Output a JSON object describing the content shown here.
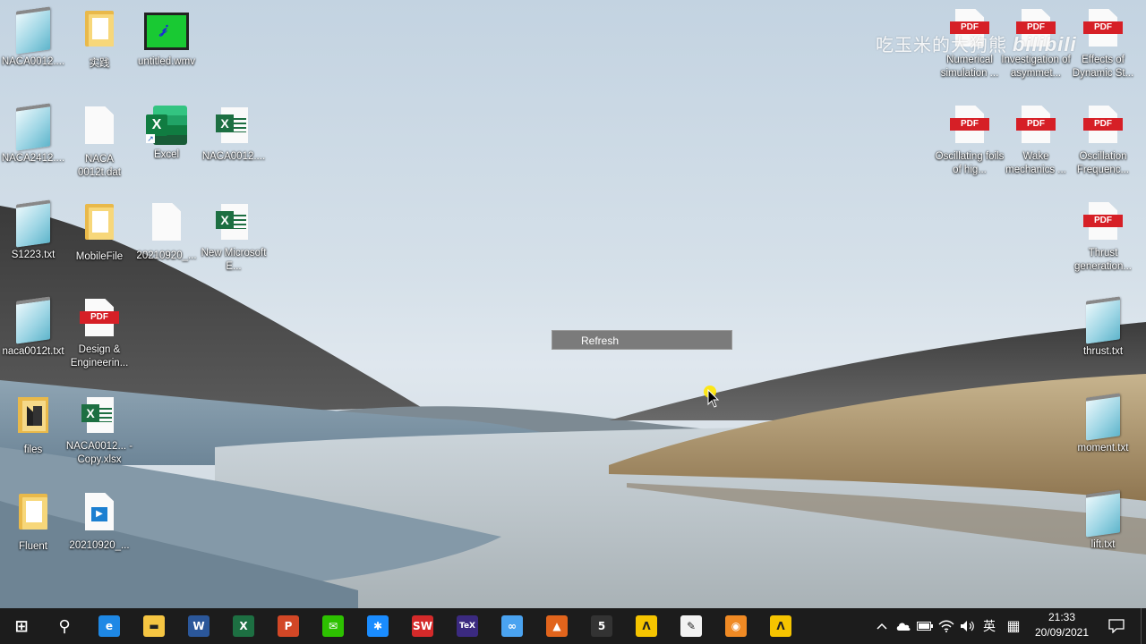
{
  "desktop": {
    "icons": [
      {
        "label": "NACA0012....",
        "type": "txt"
      },
      {
        "label": "实践",
        "type": "pdffolder"
      },
      {
        "label": "untitled.wmv",
        "type": "wmv"
      },
      {
        "label": "NACA2412....",
        "type": "txt"
      },
      {
        "label": "NACA 0012t.dat",
        "type": "doc"
      },
      {
        "label": "Excel",
        "type": "excelapp"
      },
      {
        "label": "NACA0012....",
        "type": "xlsx"
      },
      {
        "label": "S1223.txt",
        "type": "txt"
      },
      {
        "label": "MobileFile",
        "type": "folder"
      },
      {
        "label": "20210920_...",
        "type": "doc"
      },
      {
        "label": "New Microsoft E...",
        "type": "xlsx"
      },
      {
        "label": "naca0012t.txt",
        "type": "txt"
      },
      {
        "label": "Design & Engineerin...",
        "type": "pdf"
      },
      {
        "label": "files",
        "type": "ideafolder"
      },
      {
        "label": "NACA0012... - Copy.xlsx",
        "type": "xlsx"
      },
      {
        "label": "Fluent",
        "type": "folder"
      },
      {
        "label": "20210920_...",
        "type": "video"
      },
      {
        "label": "Numerical simulation ...",
        "type": "pdf"
      },
      {
        "label": "Investigation of asymmet...",
        "type": "pdf"
      },
      {
        "label": "Effects of Dynamic St...",
        "type": "pdf"
      },
      {
        "label": "Oscillating foils of hig...",
        "type": "pdf"
      },
      {
        "label": "Wake mechanics ...",
        "type": "pdf"
      },
      {
        "label": "Oscillation Frequenc...",
        "type": "pdf"
      },
      {
        "label": "Thrust generation...",
        "type": "pdf"
      },
      {
        "label": "thrust.txt",
        "type": "txt"
      },
      {
        "label": "moment.txt",
        "type": "txt"
      },
      {
        "label": "lift.txt",
        "type": "txt"
      }
    ],
    "pdf_tag": "PDF",
    "excel_letter": "X"
  },
  "context_menu": {
    "refresh_label": "Refresh"
  },
  "watermark": {
    "text": "吃玉米的大狗熊",
    "brand": "bilibili"
  },
  "taskbar": {
    "apps": [
      {
        "name": "start-button",
        "glyph": "⊞",
        "color": "#ffffff"
      },
      {
        "name": "search-button",
        "glyph": "⚲",
        "color": "#ffffff"
      },
      {
        "name": "edge-icon",
        "glyph": "e",
        "color": "#1e88e5"
      },
      {
        "name": "file-explorer-icon",
        "glyph": "▬",
        "color": "#f5c542"
      },
      {
        "name": "word-icon",
        "glyph": "W",
        "color": "#2b579a"
      },
      {
        "name": "excel-taskbar-icon",
        "glyph": "X",
        "color": "#1d6f42"
      },
      {
        "name": "powerpoint-icon",
        "glyph": "P",
        "color": "#d24726"
      },
      {
        "name": "wechat-icon",
        "glyph": "✉",
        "color": "#2dc100"
      },
      {
        "name": "star-app-icon",
        "glyph": "✱",
        "color": "#1a8cff"
      },
      {
        "name": "solidworks-icon",
        "glyph": "SW",
        "color": "#d42a2a"
      },
      {
        "name": "tex-icon",
        "glyph": "TeX",
        "color": "#3b2a80"
      },
      {
        "name": "cloud-sync-icon",
        "glyph": "∞",
        "color": "#4aa3f0"
      },
      {
        "name": "matlab-icon",
        "glyph": "▲",
        "color": "#e1641c"
      },
      {
        "name": "app-5-icon",
        "glyph": "5",
        "color": "#333333"
      },
      {
        "name": "ansys-icon",
        "glyph": "Λ",
        "color": "#f5c400"
      },
      {
        "name": "pen-tool-icon",
        "glyph": "✎",
        "color": "#f2f2f2"
      },
      {
        "name": "fluent-icon",
        "glyph": "◉",
        "color": "#f08a24"
      },
      {
        "name": "ansys-2-icon",
        "glyph": "Λ",
        "color": "#f5c400"
      }
    ],
    "tray": {
      "chevron": "^",
      "ime_label": "英",
      "grid_glyph": "▦"
    },
    "clock": {
      "time": "21:33",
      "date": "20/09/2021"
    }
  }
}
